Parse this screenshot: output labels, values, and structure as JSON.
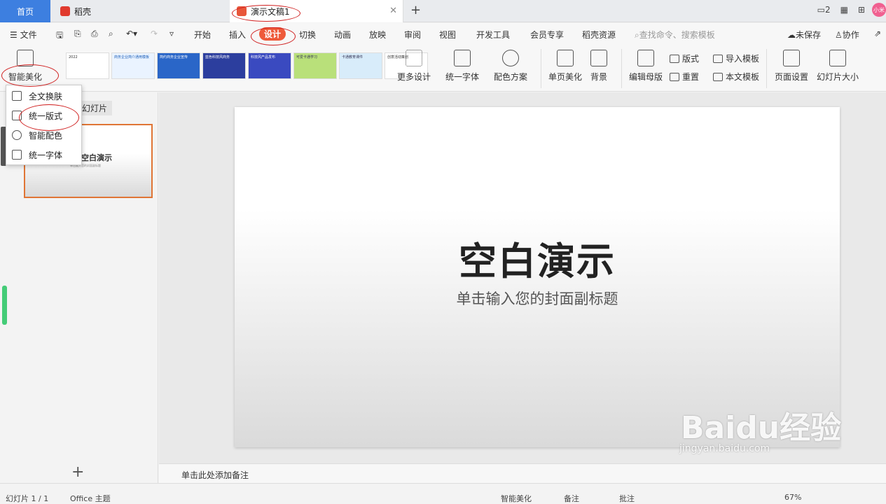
{
  "tabs": {
    "home": "首页",
    "daoke": "稻壳",
    "doc": "演示文稿1"
  },
  "menu": {
    "file": "文件",
    "items": [
      "开始",
      "插入",
      "设计",
      "切换",
      "动画",
      "放映",
      "审阅",
      "视图",
      "开发工具",
      "会员专享",
      "稻壳资源"
    ],
    "search": "查找命令、搜索模板",
    "unsaved": "未保存",
    "collab": "协作"
  },
  "ribbon": {
    "smart": "智能美化",
    "more": "更多设计",
    "font": "统一字体",
    "color": "配色方案",
    "pagebeauty": "单页美化",
    "bg": "背景",
    "master": "编辑母版",
    "layout": "版式",
    "reset": "重置",
    "import": "导入模板",
    "doc_tpl": "本文模板",
    "page_setup": "页面设置",
    "slide_size": "幻灯片大小",
    "thumbs": [
      "2022",
      "商务企业简介通用模板",
      "简约商务企业宣传",
      "蓝色科技风商务",
      "科技风产品发布",
      "可爱卡通学习",
      "卡通教育课件",
      "创意活动策划"
    ]
  },
  "dropdown": [
    "全文换肤",
    "统一版式",
    "智能配色",
    "统一字体"
  ],
  "left": {
    "tab": "幻灯片",
    "thumb_title": "空白演示",
    "thumb_sub": "单击输入您的封面副标题"
  },
  "slide": {
    "title": "空白演示",
    "subtitle": "单击输入您的封面副标题"
  },
  "notes": "单击此处添加备注",
  "status": {
    "page": "幻灯片 1 / 1",
    "theme": "Office 主题",
    "smart": "智能美化",
    "note": "备注",
    "comment": "批注",
    "zoom": "67%"
  },
  "watermark": {
    "brand": "Baidu经验",
    "url": "jingyan.baidu.com"
  }
}
